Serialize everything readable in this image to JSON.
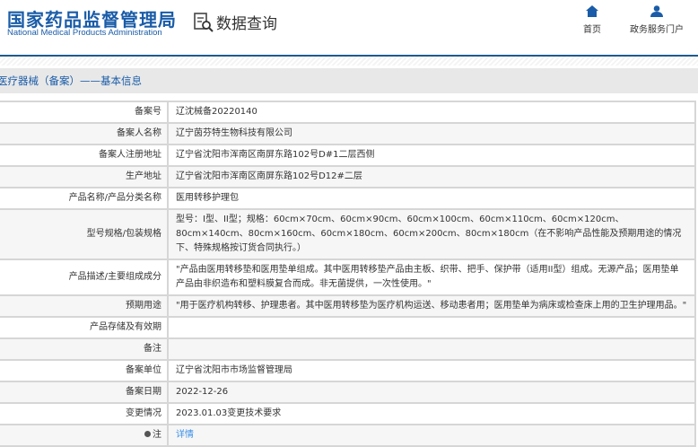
{
  "header": {
    "logo_cn": "国家药品监督管理局",
    "logo_en": "National Medical Products Administration",
    "section": "数据查询",
    "nav": [
      {
        "label": "首页",
        "icon": "home-icon"
      },
      {
        "label": "政务服务门户",
        "icon": "user-icon"
      }
    ]
  },
  "breadcrumb": "医疗器械（备案）——基本信息",
  "colors": {
    "brand": "#1a5ca8",
    "link": "#3a8ee6"
  },
  "rows": [
    {
      "label": "备案号",
      "value": "辽沈械备20220140"
    },
    {
      "label": "备案人名称",
      "value": "辽宁茵芬特生物科技有限公司"
    },
    {
      "label": "备案人注册地址",
      "value": "辽宁省沈阳市浑南区南屏东路102号D#1二层西侧"
    },
    {
      "label": "生产地址",
      "value": "辽宁省沈阳市浑南区南屏东路102号D12#二层"
    },
    {
      "label": "产品名称/产品分类名称",
      "value": "医用转移护理包"
    },
    {
      "label": "型号规格/包装规格",
      "value": "型号：I型、II型；规格：60cm×70cm、60cm×90cm、60cm×100cm、60cm×110cm、60cm×120cm、80cm×140cm、80cm×160cm、60cm×180cm、60cm×200cm、80cm×180cm（在不影响产品性能及预期用途的情况下、特殊规格按订货合同执行。）"
    },
    {
      "label": "产品描述/主要组成成分",
      "value": "\"产品由医用转移垫和医用垫单组成。其中医用转移垫产品由主板、织带、把手、保护带（适用II型）组成。无源产品；医用垫单产品由非织造布和塑料膜复合而成。非无菌提供，一次性使用。\""
    },
    {
      "label": "预期用途",
      "value": "\"用于医疗机构转移、护理患者。其中医用转移垫为医疗机构运送、移动患者用；医用垫单为病床或检查床上用的卫生护理用品。\""
    },
    {
      "label": "产品存储及有效期",
      "value": ""
    },
    {
      "label": "备注",
      "value": ""
    },
    {
      "label": "备案单位",
      "value": "辽宁省沈阳市市场监督管理局"
    },
    {
      "label": "备案日期",
      "value": "2022-12-26"
    },
    {
      "label": "变更情况",
      "value": "2023.01.03变更技术要求"
    },
    {
      "label": "注",
      "value": "详情"
    }
  ]
}
